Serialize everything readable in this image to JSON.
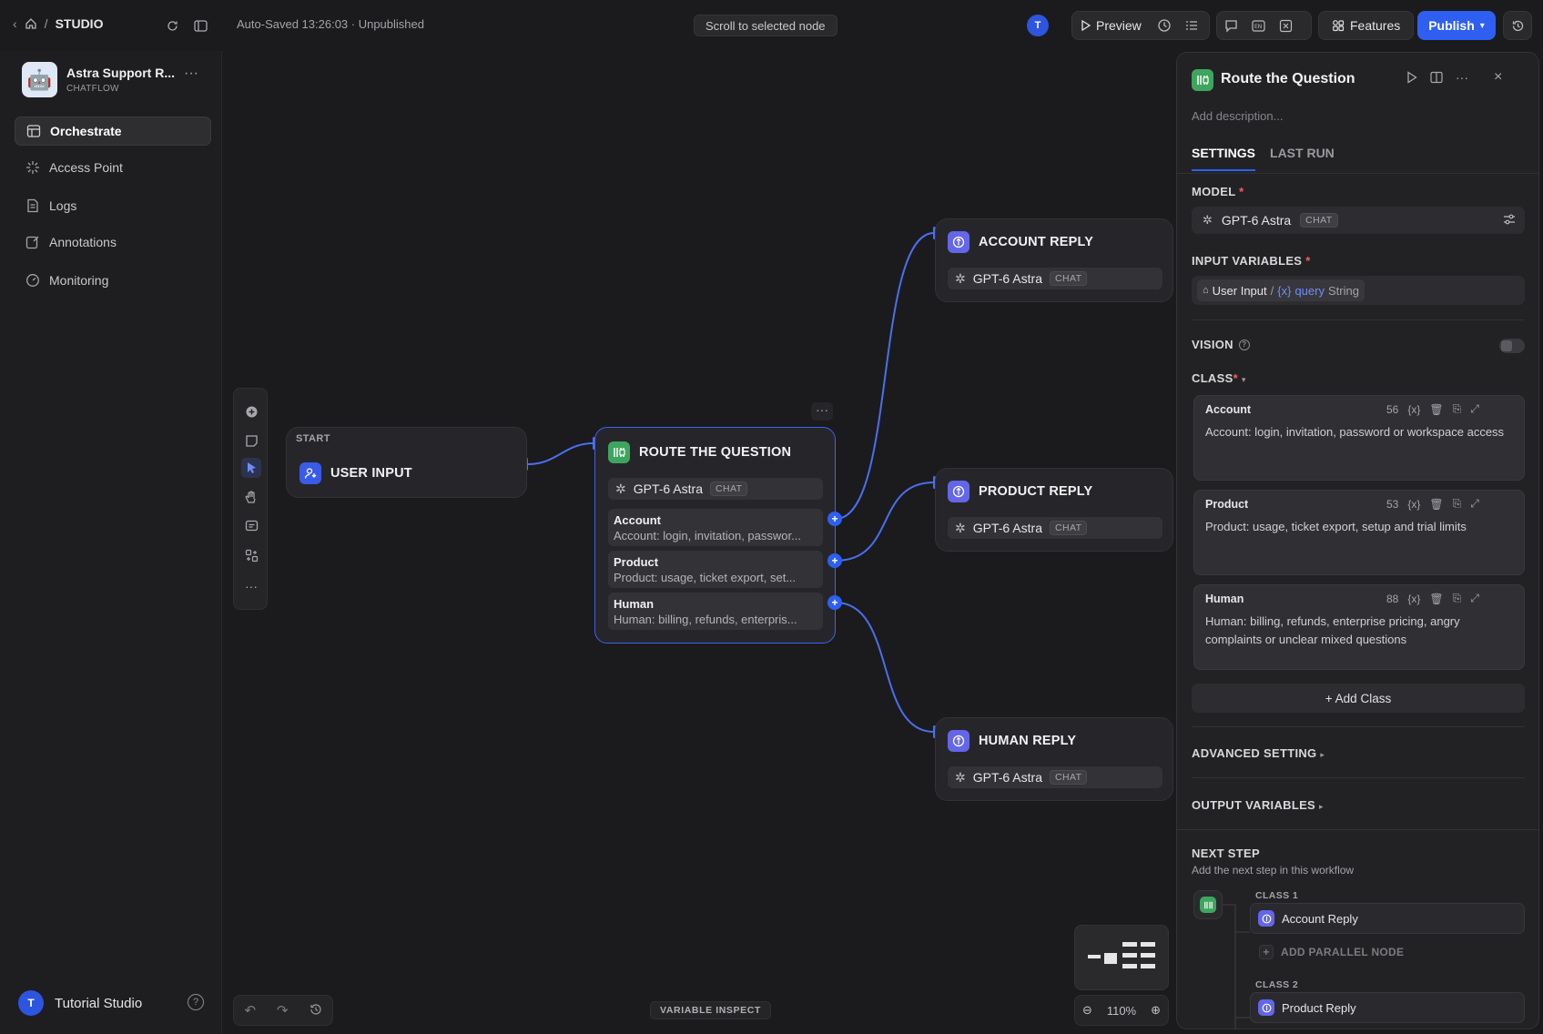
{
  "topbar": {
    "breadcrumb": "STUDIO",
    "autosave": "Auto-Saved 13:26:03 · Unpublished",
    "scroll_button": "Scroll to selected node",
    "avatar_initial": "T",
    "preview_label": "Preview",
    "features_label": "Features",
    "publish_label": "Publish"
  },
  "sidebar": {
    "app_name": "Astra Support R...",
    "app_type": "CHATFLOW",
    "items": [
      {
        "label": "Orchestrate",
        "active": true
      },
      {
        "label": "Access Point"
      },
      {
        "label": "Logs"
      },
      {
        "label": "Annotations"
      },
      {
        "label": "Monitoring"
      }
    ],
    "user_initial": "T",
    "user_name": "Tutorial Studio"
  },
  "canvas": {
    "start_node": {
      "kicker": "START",
      "title": "USER INPUT"
    },
    "route_node": {
      "title": "ROUTE THE QUESTION",
      "model": "GPT-6 Astra",
      "model_tag": "CHAT",
      "classes": [
        {
          "name": "Account",
          "desc": "Account: login, invitation, passwor..."
        },
        {
          "name": "Product",
          "desc": "Product: usage, ticket export, set..."
        },
        {
          "name": "Human",
          "desc": "Human: billing, refunds, enterpris..."
        }
      ]
    },
    "reply_nodes": [
      {
        "title": "ACCOUNT REPLY",
        "model": "GPT-6 Astra",
        "model_tag": "CHAT"
      },
      {
        "title": "PRODUCT REPLY",
        "model": "GPT-6 Astra",
        "model_tag": "CHAT"
      },
      {
        "title": "HUMAN REPLY",
        "model": "GPT-6 Astra",
        "model_tag": "CHAT"
      }
    ],
    "variable_inspect": "VARIABLE INSPECT",
    "zoom": "110%"
  },
  "panel": {
    "title": "Route the Question",
    "description_placeholder": "Add description...",
    "tabs": [
      {
        "label": "SETTINGS",
        "active": true
      },
      {
        "label": "LAST RUN"
      }
    ],
    "model_label": "MODEL",
    "model_name": "GPT-6 Astra",
    "model_tag": "CHAT",
    "input_vars_label": "INPUT VARIABLES",
    "input_var": {
      "source": "User Input",
      "sep": "/",
      "prefix": "{x}",
      "name": "query",
      "type": "String"
    },
    "vision_label": "VISION",
    "class_label": "CLASS",
    "classes": [
      {
        "title": "Account",
        "count": "56",
        "body": "Account: login, invitation, password or workspace access"
      },
      {
        "title": "Product",
        "count": "53",
        "body": "Product: usage, ticket export, setup and trial limits"
      },
      {
        "title": "Human",
        "count": "88",
        "body": "Human: billing, refunds, enterprise pricing, angry complaints or unclear mixed questions"
      }
    ],
    "add_class": "+ Add Class",
    "advanced_label": "ADVANCED SETTING",
    "output_label": "OUTPUT VARIABLES",
    "next_step_label": "NEXT STEP",
    "next_step_sub": "Add the next step in this workflow",
    "next_classes": [
      {
        "label": "CLASS 1",
        "target": "Account Reply",
        "parallel": "ADD PARALLEL NODE"
      },
      {
        "label": "CLASS 2",
        "target": "Product Reply"
      }
    ]
  },
  "colors": {
    "accent": "#2e5ff1",
    "edge": "#4a6ff0",
    "green": "#3ea55f",
    "purple": "#6466e9"
  }
}
